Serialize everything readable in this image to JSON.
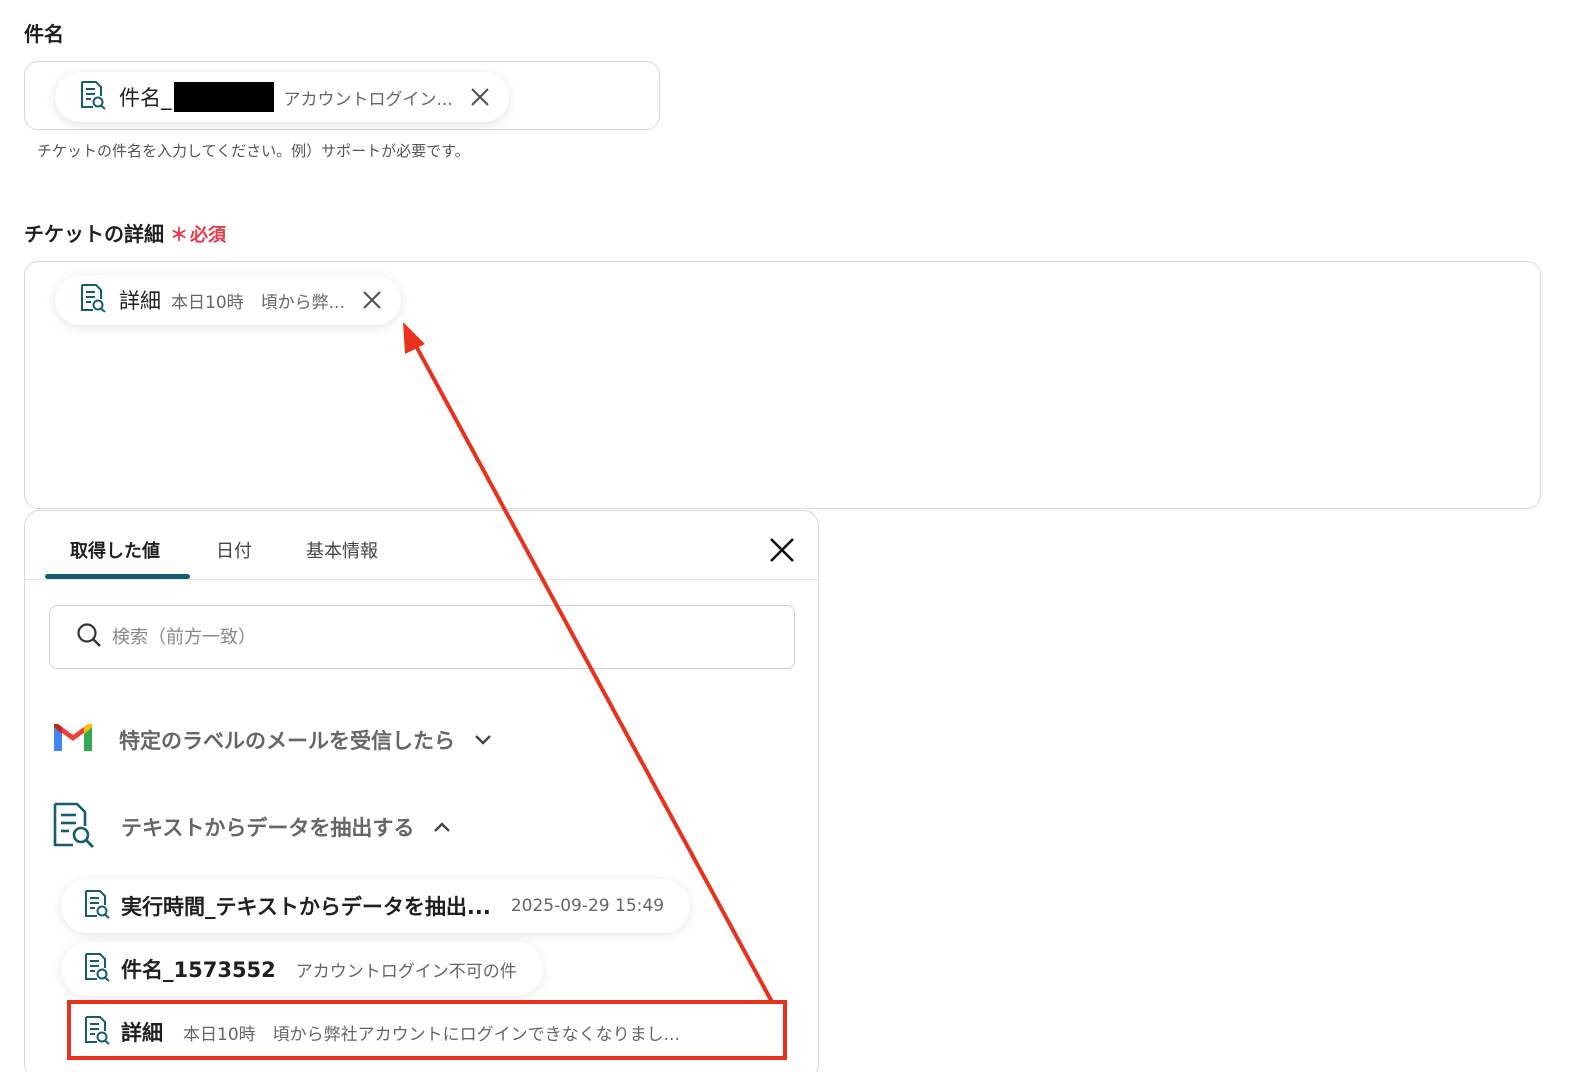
{
  "subject_field": {
    "label": "件名",
    "chip": {
      "key": "件名_",
      "value": "アカウントログイン...",
      "redacted": true
    },
    "hint": "チケットの件名を入力してください。例）サポートが必要です。"
  },
  "detail_field": {
    "label": "チケットの詳細",
    "required_mark": "＊",
    "required_text": "必須",
    "chip": {
      "key": "詳細",
      "value": "本日10時　頃から弊..."
    }
  },
  "panel": {
    "tabs": [
      {
        "label": "取得した値",
        "active": true
      },
      {
        "label": "日付",
        "active": false
      },
      {
        "label": "基本情報",
        "active": false
      }
    ],
    "search_placeholder": "検索（前方一致）",
    "groups": [
      {
        "title": "特定のラベルのメールを受信したら",
        "icon": "gmail-icon",
        "expanded": false
      },
      {
        "title": "テキストからデータを抽出する",
        "icon": "document-search-icon",
        "expanded": true
      }
    ],
    "items": [
      {
        "key": "実行時間_テキストからデータを抽出...",
        "value": "2025-09-29 15:49"
      },
      {
        "key": "件名_1573552",
        "value": "アカウントログイン不可の件"
      },
      {
        "key": "詳細",
        "value": "本日10時　頃から弊社アカウントにログインできなくなりまし..."
      }
    ]
  },
  "colors": {
    "accent": "#165d70",
    "required": "#e8394b",
    "annotation": "#e8321e"
  }
}
